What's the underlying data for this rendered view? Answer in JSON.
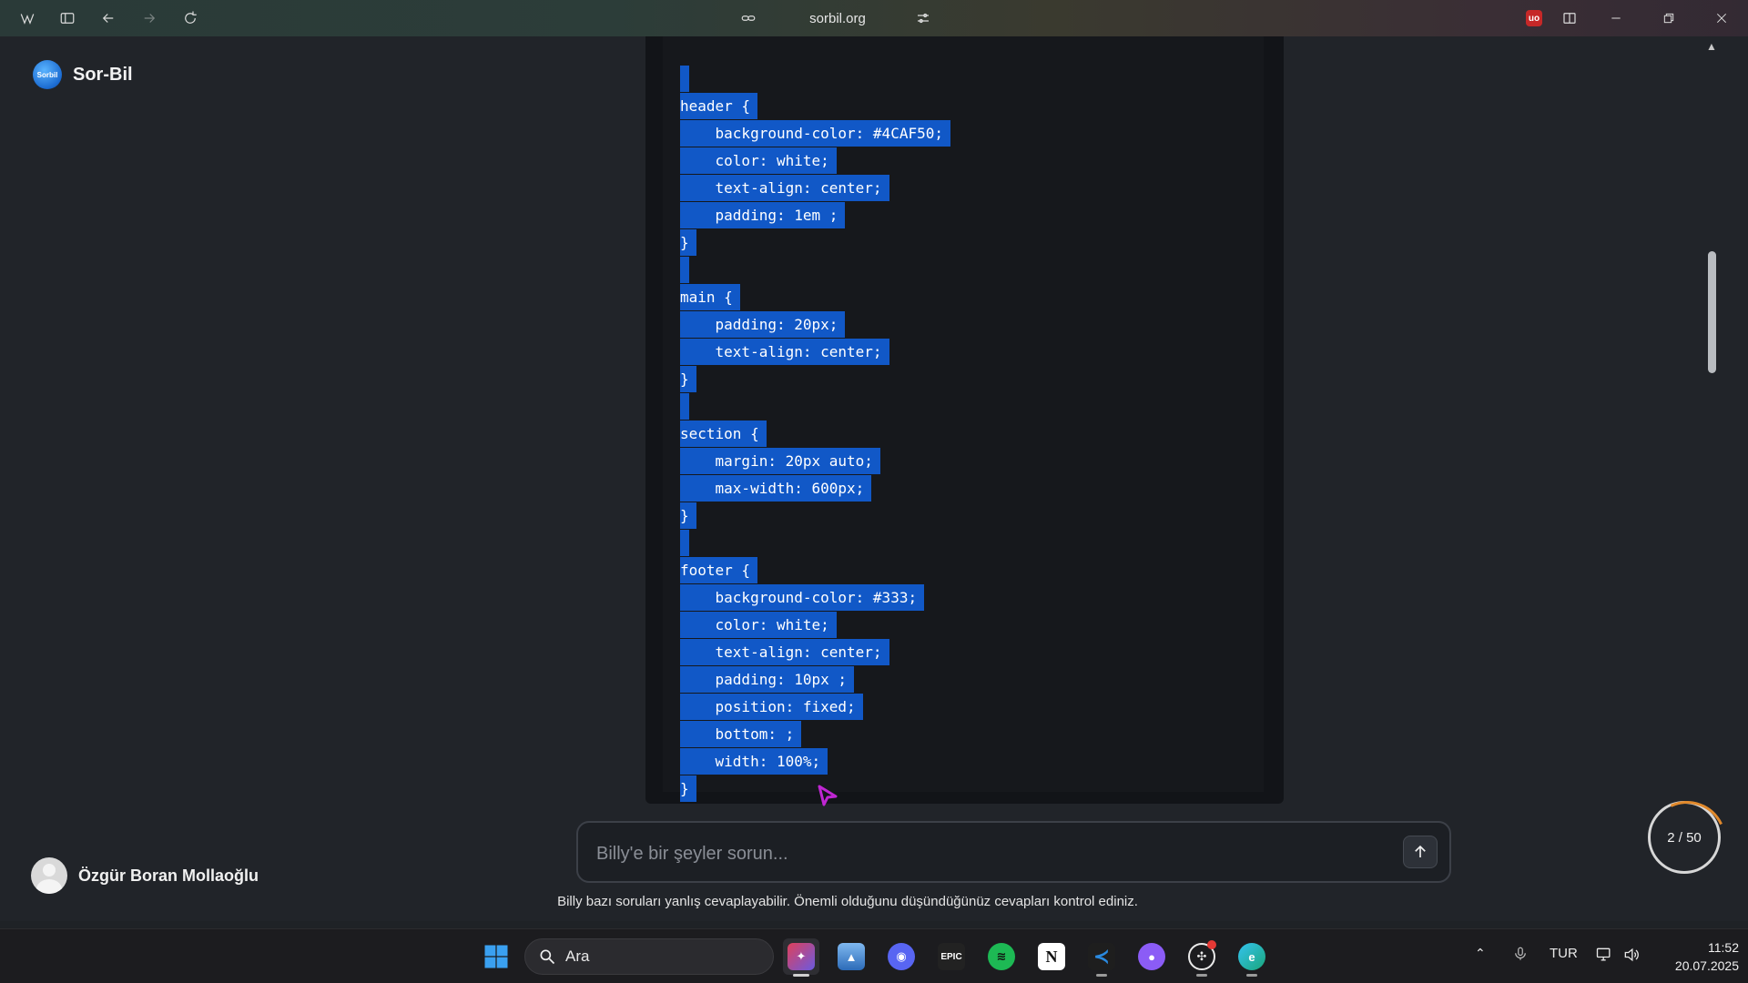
{
  "browser": {
    "url": "sorbil.org"
  },
  "sidebar": {
    "brand_name": "Sor-Bil",
    "logo_text": "Sorbil",
    "user_name": "Özgür Boran Mollaoğlu"
  },
  "code_lines": [
    "",
    "header {",
    "    background-color: #4CAF50;",
    "    color: white;",
    "    text-align: center;",
    "    padding: 1em ;",
    "}",
    "",
    "main {",
    "    padding: 20px;",
    "    text-align: center;",
    "}",
    "",
    "section {",
    "    margin: 20px auto;",
    "    max-width: 600px;",
    "}",
    "",
    "footer {",
    "    background-color: #333;",
    "    color: white;",
    "    text-align: center;",
    "    padding: 10px ;",
    "    position: fixed;",
    "    bottom: ;",
    "    width: 100%;",
    "}"
  ],
  "chat": {
    "placeholder": "Billy'e bir şeyler sorun...",
    "disclaimer": "Billy bazı soruları yanlış cevaplayabilir. Önemli olduğunu düşündüğünüz cevapları kontrol ediniz.",
    "counter": "2 / 50"
  },
  "taskbar": {
    "search_label": "Ara",
    "language": "TUR",
    "time": "11:52",
    "date": "20.07.2025",
    "apps": [
      {
        "name": "windows-start",
        "color": "#3aa0f0"
      },
      {
        "name": "browser",
        "color": "#e0405a"
      },
      {
        "name": "photos",
        "color": "#4a7fc4"
      },
      {
        "name": "discord",
        "color": "#5865f2"
      },
      {
        "name": "epic-games",
        "color": "#2a2a2a"
      },
      {
        "name": "spotify",
        "color": "#1db954"
      },
      {
        "name": "notion",
        "color": "#ffffff"
      },
      {
        "name": "vscode",
        "color": "#2a8ae0"
      },
      {
        "name": "github",
        "color": "#8b5cf6"
      },
      {
        "name": "chatgpt",
        "color": "#eaeaea"
      },
      {
        "name": "edge",
        "color": "#1aa67a"
      }
    ]
  },
  "colors": {
    "selection": "#1158c7",
    "page_bg": "#212429",
    "code_bg": "#16181c",
    "accent_orange": "#e0892c"
  }
}
